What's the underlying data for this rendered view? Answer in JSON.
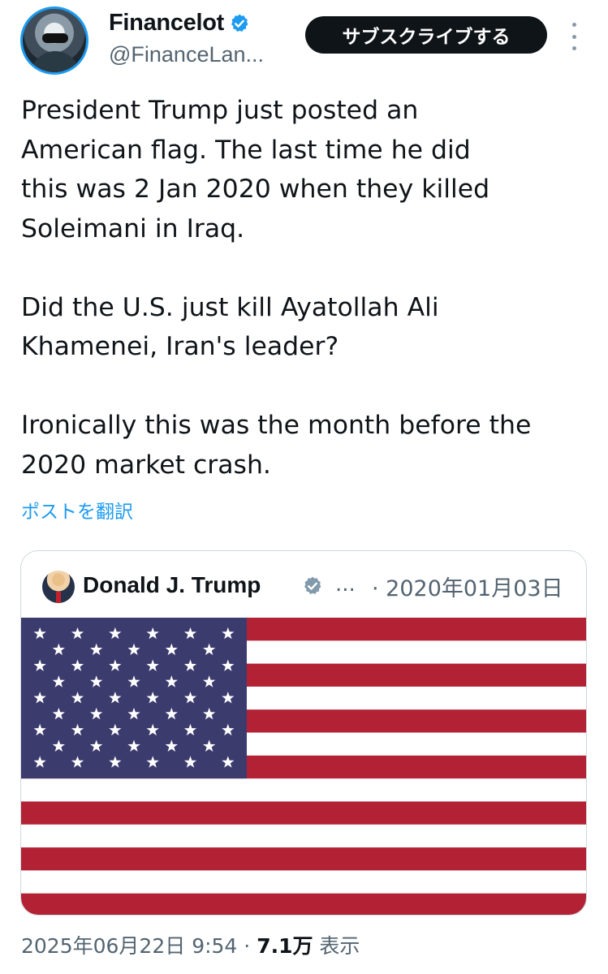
{
  "author": {
    "display_name": "Financelot",
    "handle": "@FinanceLan...",
    "verified": true
  },
  "header": {
    "subscribe_label": "サブスクライブする",
    "more_icon": "more-vertical-icon"
  },
  "tweet": {
    "text": "President Trump just posted an\nAmerican flag. The last time he did\nthis was 2 Jan 2020 when they killed\nSoleimani in Iraq.\n\nDid the U.S. just kill Ayatollah Ali\nKhamenei, Iran's leader?\n\nIronically this was the month before the\n2020 market crash.",
    "translate_label": "ポストを翻訳"
  },
  "quote": {
    "author_name": "Donald J. Trump",
    "verified": true,
    "ellipsis": "...",
    "date": "· 2020年01月03日",
    "media": "american-flag-image"
  },
  "meta": {
    "timestamp": "2025年06月22日 9:54",
    "separator": " · ",
    "views_count": "7.1万",
    "views_label": " 表示"
  },
  "colors": {
    "accent": "#1d9bf0",
    "text_primary": "#0f1419",
    "text_secondary": "#536471",
    "flag_red": "#b22234",
    "flag_blue": "#3c3b6e"
  }
}
